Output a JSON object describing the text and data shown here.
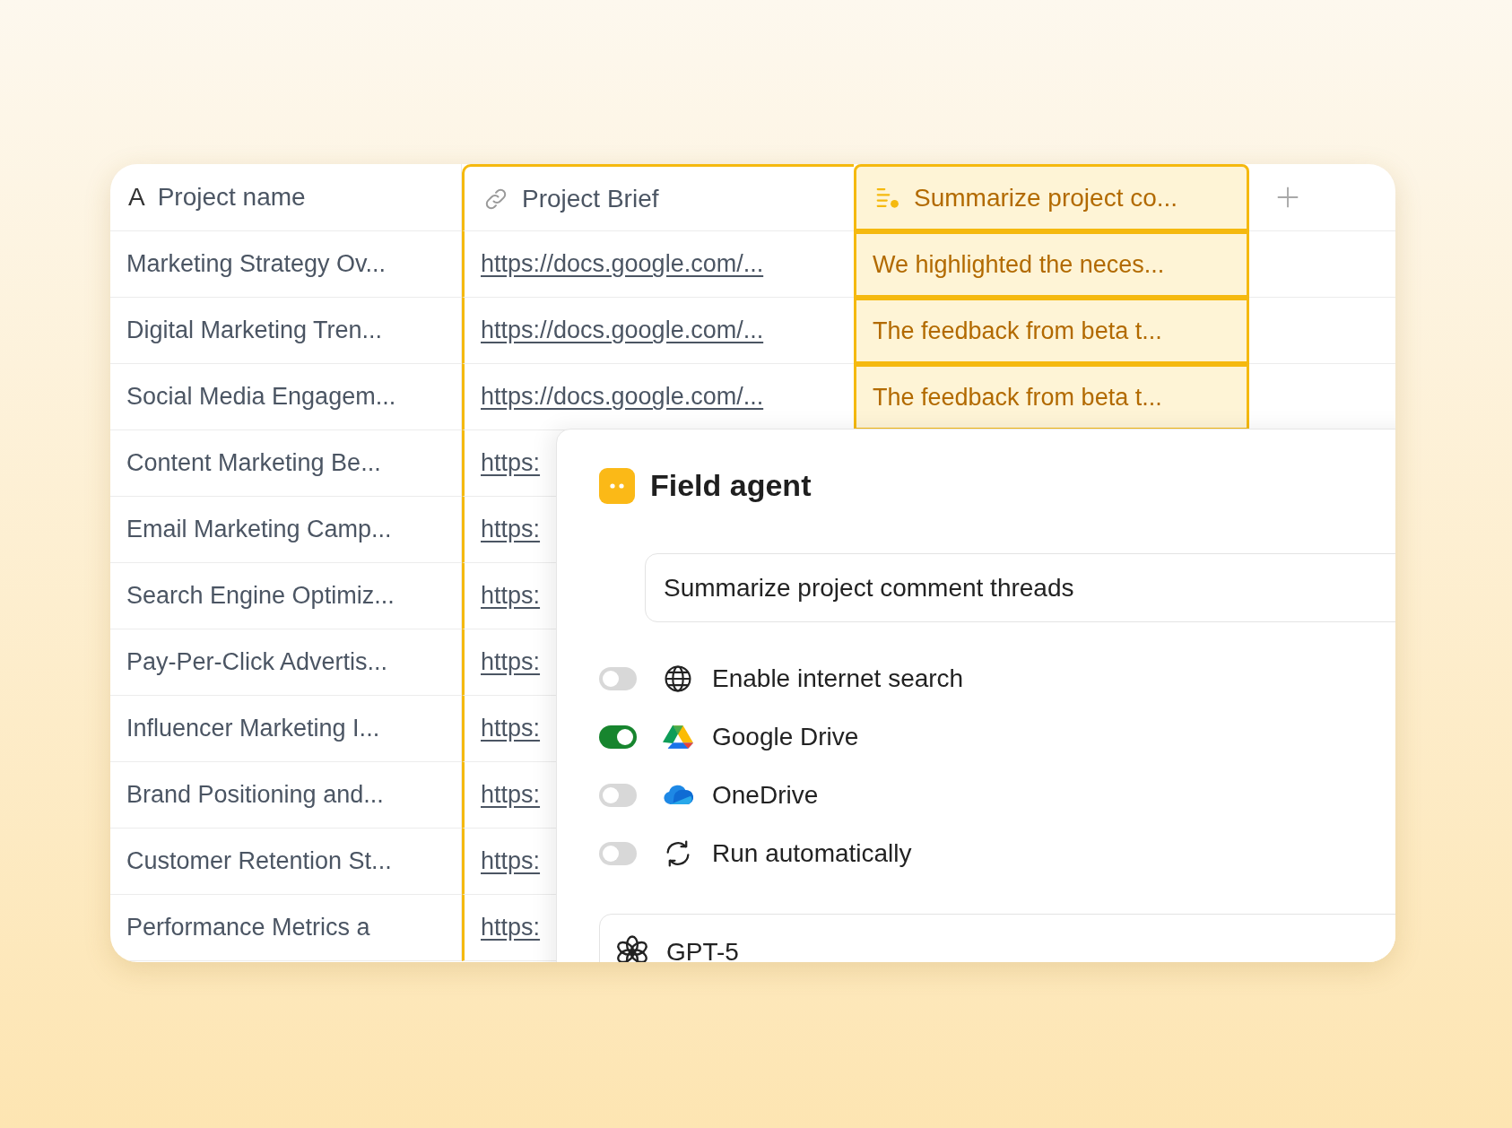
{
  "table": {
    "columns": [
      {
        "label": "Project name",
        "kind": "text",
        "glyph": "A",
        "selected": false
      },
      {
        "label": "Project Brief",
        "kind": "link",
        "selected": true
      },
      {
        "label": "Summarize project co...",
        "kind": "agent",
        "selected": true
      }
    ],
    "rows": [
      {
        "cells": [
          "Marketing Strategy Ov...",
          "https://docs.google.com/...",
          "We highlighted the neces..."
        ]
      },
      {
        "cells": [
          "Digital Marketing Tren...",
          "https://docs.google.com/...",
          "The feedback from beta t..."
        ]
      },
      {
        "cells": [
          "Social Media Engagem...",
          "https://docs.google.com/...",
          "The feedback from beta t..."
        ]
      },
      {
        "cells": [
          "Content Marketing Be...",
          "https:"
        ]
      },
      {
        "cells": [
          "Email Marketing Camp...",
          "https:"
        ]
      },
      {
        "cells": [
          "Search Engine Optimiz...",
          "https:"
        ]
      },
      {
        "cells": [
          "Pay-Per-Click Advertis...",
          "https:"
        ]
      },
      {
        "cells": [
          "Influencer Marketing I...",
          "https:"
        ]
      },
      {
        "cells": [
          "Brand Positioning and...",
          "https:"
        ]
      },
      {
        "cells": [
          "Customer Retention St...",
          "https:"
        ]
      },
      {
        "cells": [
          "Performance Metrics a",
          "https:"
        ]
      }
    ]
  },
  "field_agent": {
    "title": "Field agent",
    "prompt": "Summarize project comment threads",
    "options": [
      {
        "kind": "internet",
        "label": "Enable internet search",
        "on": false
      },
      {
        "kind": "google-drive",
        "label": "Google Drive",
        "on": true
      },
      {
        "kind": "onedrive",
        "label": "OneDrive",
        "on": false
      },
      {
        "kind": "sync",
        "label": "Run automatically",
        "on": false
      }
    ],
    "model": "GPT-5"
  }
}
